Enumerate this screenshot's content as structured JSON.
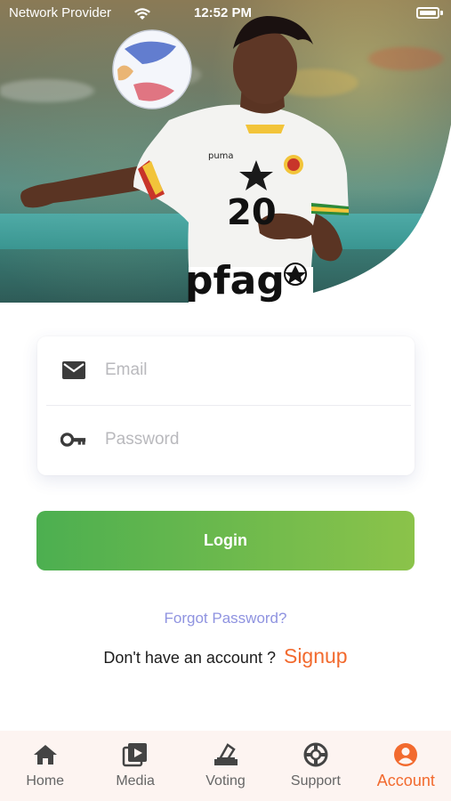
{
  "status_bar": {
    "carrier": "Network Provider",
    "time": "12:52 PM"
  },
  "hero": {
    "jersey_number": "20",
    "brand_text": "pfag"
  },
  "form": {
    "email_placeholder": "Email",
    "password_placeholder": "Password",
    "email_value": "",
    "password_value": ""
  },
  "login_label": "Login",
  "forgot_label": "Forgot Password?",
  "signup": {
    "prompt": "Don't have an account ?",
    "link": "Signup"
  },
  "tabs": [
    {
      "label": "Home",
      "icon": "home-icon",
      "active": false
    },
    {
      "label": "Media",
      "icon": "media-icon",
      "active": false
    },
    {
      "label": "Voting",
      "icon": "voting-icon",
      "active": false
    },
    {
      "label": "Support",
      "icon": "support-icon",
      "active": false
    },
    {
      "label": "Account",
      "icon": "account-icon",
      "active": true
    }
  ],
  "colors": {
    "accent": "#f26a2e",
    "button_start": "#4caf50",
    "button_end": "#8bc34a",
    "link": "#8f93e0",
    "tab_inactive": "#666666"
  }
}
